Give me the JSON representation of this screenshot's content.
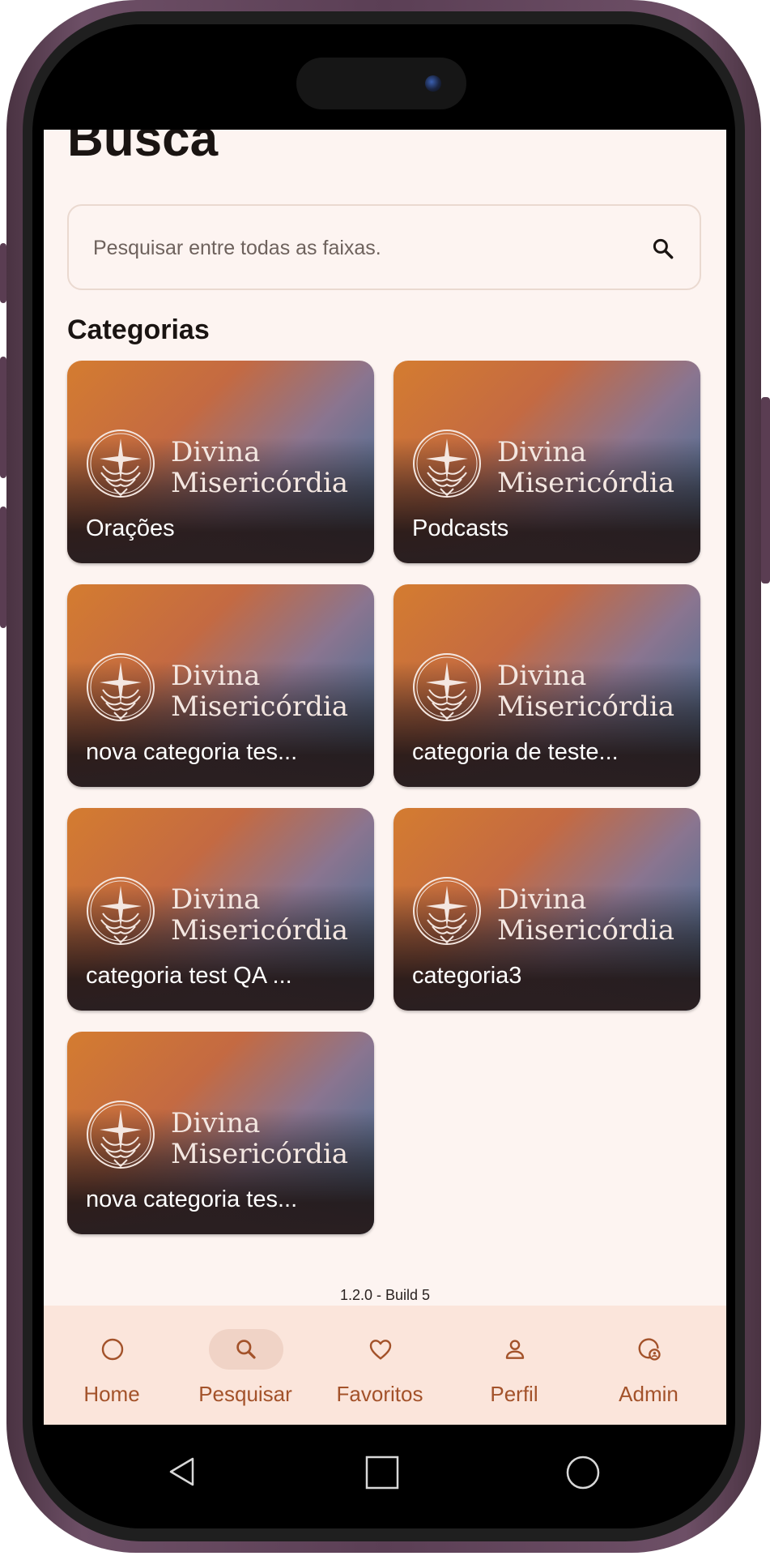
{
  "colors": {
    "screen_bg": "#fdf4f1",
    "nav_bg": "#fbe5db",
    "accent": "#a3522a",
    "card_gradient": [
      "#d47c30",
      "#c46a42",
      "#8a7590",
      "#2f6a94"
    ]
  },
  "page": {
    "title": "Busca"
  },
  "search": {
    "placeholder": "Pesquisar entre todas as faixas.",
    "icon": "search-icon"
  },
  "categories": {
    "heading": "Categorias",
    "logo_text": [
      "Divina",
      "Misericórdia"
    ],
    "items": [
      {
        "label": "Orações"
      },
      {
        "label": "Podcasts"
      },
      {
        "label": "nova categoria tes..."
      },
      {
        "label": "categoria de teste..."
      },
      {
        "label": "categoria test QA ..."
      },
      {
        "label": "categoria3"
      },
      {
        "label": "nova categoria tes..."
      }
    ]
  },
  "build": {
    "label": "1.2.0 - Build 5"
  },
  "nav": {
    "active": "Pesquisar",
    "items": [
      {
        "label": "Home",
        "icon": "circle-icon"
      },
      {
        "label": "Pesquisar",
        "icon": "search-icon"
      },
      {
        "label": "Favoritos",
        "icon": "heart-icon"
      },
      {
        "label": "Perfil",
        "icon": "person-icon"
      },
      {
        "label": "Admin",
        "icon": "admin-settings-icon"
      }
    ]
  },
  "system_nav": {
    "icons": [
      "back-triangle-icon",
      "home-square-icon",
      "recents-circle-icon"
    ]
  }
}
